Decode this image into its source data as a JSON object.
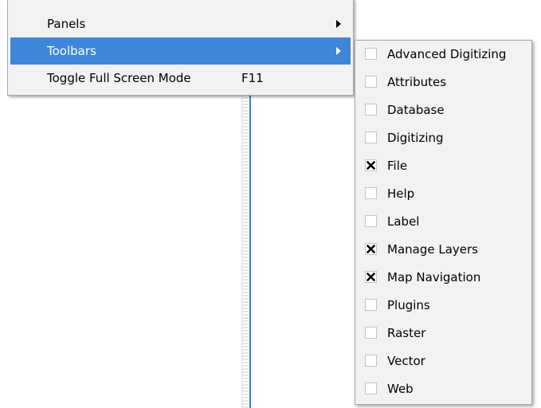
{
  "view_menu": {
    "items": [
      {
        "label": "Panels",
        "shortcut": "",
        "has_submenu": true,
        "active": false
      },
      {
        "label": "Toolbars",
        "shortcut": "",
        "has_submenu": true,
        "active": true
      },
      {
        "label": "Toggle Full Screen Mode",
        "shortcut": "F11",
        "has_submenu": false,
        "active": false
      }
    ]
  },
  "toolbars_submenu": {
    "items": [
      {
        "label": "Advanced Digitizing",
        "checked": false
      },
      {
        "label": "Attributes",
        "checked": false
      },
      {
        "label": "Database",
        "checked": false
      },
      {
        "label": "Digitizing",
        "checked": false
      },
      {
        "label": "File",
        "checked": true
      },
      {
        "label": "Help",
        "checked": false
      },
      {
        "label": "Label",
        "checked": false
      },
      {
        "label": "Manage Layers",
        "checked": true
      },
      {
        "label": "Map Navigation",
        "checked": true
      },
      {
        "label": "Plugins",
        "checked": false
      },
      {
        "label": "Raster",
        "checked": false
      },
      {
        "label": "Vector",
        "checked": false
      },
      {
        "label": "Web",
        "checked": false
      }
    ]
  },
  "colors": {
    "highlight": "#3f86d8",
    "menu_background": "#f2f2f2",
    "splitter_accent": "#2f7fd3"
  }
}
